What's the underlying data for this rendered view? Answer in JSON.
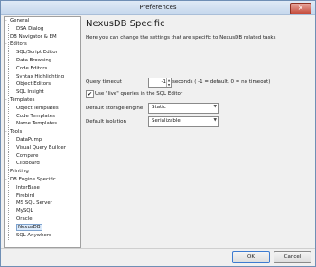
{
  "window": {
    "title": "Preferences"
  },
  "tree": {
    "items": [
      {
        "label": "General",
        "toggle": "-",
        "level": 0
      },
      {
        "label": "DSA Dialog",
        "toggle": "",
        "level": 1
      },
      {
        "label": "DB Navigator & EM",
        "toggle": "",
        "level": 0
      },
      {
        "label": "Editors",
        "toggle": "-",
        "level": 0
      },
      {
        "label": "SQL/Script Editor",
        "toggle": "",
        "level": 1
      },
      {
        "label": "Data Browsing",
        "toggle": "",
        "level": 1
      },
      {
        "label": "Code Editors",
        "toggle": "",
        "level": 1
      },
      {
        "label": "Syntax Highlighting",
        "toggle": "",
        "level": 1
      },
      {
        "label": "Object Editors",
        "toggle": "",
        "level": 1
      },
      {
        "label": "SQL Insight",
        "toggle": "",
        "level": 1
      },
      {
        "label": "Templates",
        "toggle": "-",
        "level": 0
      },
      {
        "label": "Object Templates",
        "toggle": "",
        "level": 1
      },
      {
        "label": "Code Templates",
        "toggle": "",
        "level": 1
      },
      {
        "label": "Name Templates",
        "toggle": "",
        "level": 1
      },
      {
        "label": "Tools",
        "toggle": "-",
        "level": 0
      },
      {
        "label": "DataPump",
        "toggle": "",
        "level": 1
      },
      {
        "label": "Visual Query Builder",
        "toggle": "",
        "level": 1
      },
      {
        "label": "Compare",
        "toggle": "",
        "level": 1
      },
      {
        "label": "Clipboard",
        "toggle": "",
        "level": 1
      },
      {
        "label": "Printing",
        "toggle": "",
        "level": 0
      },
      {
        "label": "DB Engine Specific",
        "toggle": "-",
        "level": 0
      },
      {
        "label": "InterBase",
        "toggle": "",
        "level": 1
      },
      {
        "label": "Firebird",
        "toggle": "",
        "level": 1
      },
      {
        "label": "MS SQL Server",
        "toggle": "",
        "level": 1
      },
      {
        "label": "MySQL",
        "toggle": "",
        "level": 1
      },
      {
        "label": "Oracle",
        "toggle": "",
        "level": 1
      },
      {
        "label": "NexusDB",
        "toggle": "",
        "level": 1,
        "selected": true
      },
      {
        "label": "SQL Anywhere",
        "toggle": "",
        "level": 1
      }
    ]
  },
  "panel": {
    "heading": "NexusDB Specific",
    "description": "Here you can change the settings that are specific to NexusDB related tasks",
    "query_timeout": {
      "label": "Query timeout",
      "value": "-1",
      "suffix": "seconds ( -1 = default, 0 = no timeout)"
    },
    "live_queries": {
      "label": "Use \"live\" queries in the SQL Editor",
      "checked": true,
      "mark": "✔"
    },
    "storage_engine": {
      "label": "Default storage engine",
      "value": "Static"
    },
    "isolation": {
      "label": "Default isolation",
      "value": "Serializable"
    }
  },
  "buttons": {
    "ok": "OK",
    "cancel": "Cancel"
  }
}
